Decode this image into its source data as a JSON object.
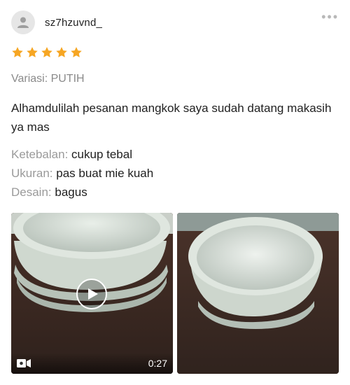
{
  "review": {
    "username": "sz7hzuvnd_",
    "rating": 5,
    "more_icon": "more-dots-icon",
    "variant": "Variasi: PUTIH",
    "comment": "Alhamdulilah pesanan mangkok saya sudah datang makasih ya mas",
    "attributes": [
      {
        "key": "Ketebalan:",
        "value": "cukup tebal"
      },
      {
        "key": "Ukuran:",
        "value": "pas buat mie kuah"
      },
      {
        "key": "Desain:",
        "value": "bagus"
      }
    ],
    "media": [
      {
        "type": "video",
        "duration": "0:27"
      },
      {
        "type": "photo"
      }
    ]
  },
  "colors": {
    "star": "#f6a623",
    "meta_text": "#9a9a9a",
    "text": "#212121"
  }
}
